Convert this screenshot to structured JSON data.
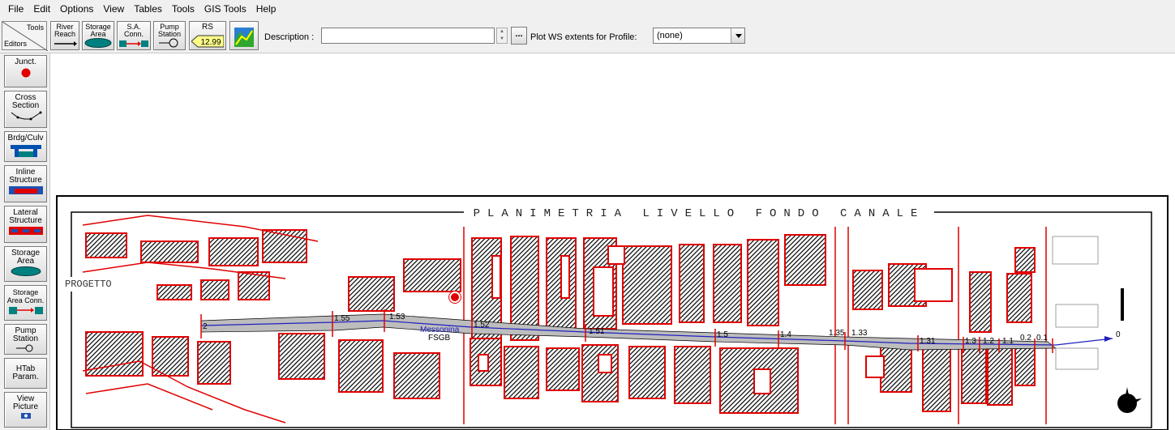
{
  "menu": [
    "File",
    "Edit",
    "Options",
    "View",
    "Tables",
    "Tools",
    "GIS Tools",
    "Help"
  ],
  "toolbar": {
    "corner_tools": "Tools",
    "corner_editors": "Editors",
    "buttons": [
      {
        "label": "River\nReach"
      },
      {
        "label": "Storage\nArea"
      },
      {
        "label": "S.A.\nConn."
      },
      {
        "label": "Pump\nStation"
      },
      {
        "label": "RS",
        "value": "12.99"
      }
    ],
    "description_label": "Description :",
    "description_value": "",
    "ellipsis_label": "...",
    "plot_ws_label": "Plot WS extents for Profile:",
    "profile_selected": "(none)"
  },
  "editors": [
    {
      "label": "Junct."
    },
    {
      "label": "Cross\nSection"
    },
    {
      "label": "Brdg/Culv"
    },
    {
      "label": "Inline\nStructure"
    },
    {
      "label": "Lateral\nStructure"
    },
    {
      "label": "Storage\nArea"
    },
    {
      "label": "Storage\nArea Conn."
    },
    {
      "label": "Pump\nStation"
    },
    {
      "label": "HTab\nParam."
    },
    {
      "label": "View\nPicture"
    }
  ],
  "map": {
    "title": "PLANIMETRIA LIVELLO FONDO CANALE",
    "side_label": "PROGETTO",
    "reach_name": "Messonina",
    "reach_sub": "FSGB",
    "cross_sections": [
      "2",
      "1.55",
      "1.53",
      "1.52",
      "1.51",
      "1.5",
      "1.4",
      "1.35",
      "1.33",
      "1.31",
      "1.3",
      "1.2",
      "1.1",
      "0.2",
      "0.1",
      "0"
    ]
  },
  "colors": {
    "building_outline": "#e00000",
    "channel_fill": "#bdbdbd",
    "reach_line": "#2020c0"
  }
}
